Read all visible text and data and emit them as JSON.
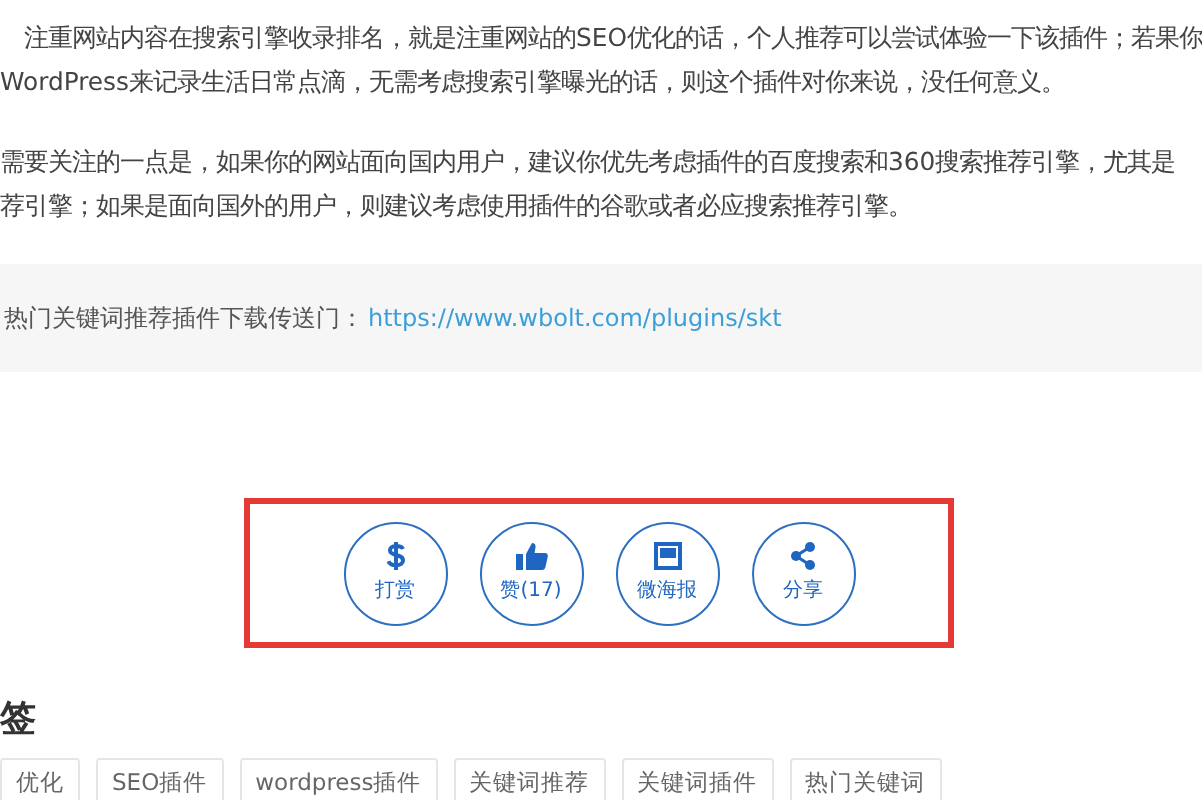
{
  "article": {
    "paragraphs": [
      [
        "注重网站内容在搜索引擎收录排名，就是注重网站的SEO优化的话，个人推荐可以尝试体验一下该插件；若果你",
        "WordPress来记录生活日常点滴，无需考虑搜索引擎曝光的话，则这个插件对你来说，没任何意义。"
      ],
      [
        "需要关注的一点是，如果你的网站面向国内用户，建议你优先考虑插件的百度搜索和360搜索推荐引擎，尤其是",
        "荐引擎；如果是面向国外的用户，则建议考虑使用插件的谷歌或者必应搜索推荐引擎。"
      ]
    ]
  },
  "download": {
    "label": "热门关键词推荐插件下载传送门：",
    "link": "https://www.wbolt.com/plugins/skt"
  },
  "actions": [
    {
      "kind": "dollar",
      "label": "打赏"
    },
    {
      "kind": "thumb",
      "label": "赞(17)"
    },
    {
      "kind": "poster",
      "label": "微海报"
    },
    {
      "kind": "share",
      "label": "分享"
    }
  ],
  "tags": {
    "heading": "签",
    "items": [
      "优化",
      "SEO插件",
      "wordpress插件",
      "关键词推荐",
      "关键词插件",
      "热门关键词"
    ]
  }
}
